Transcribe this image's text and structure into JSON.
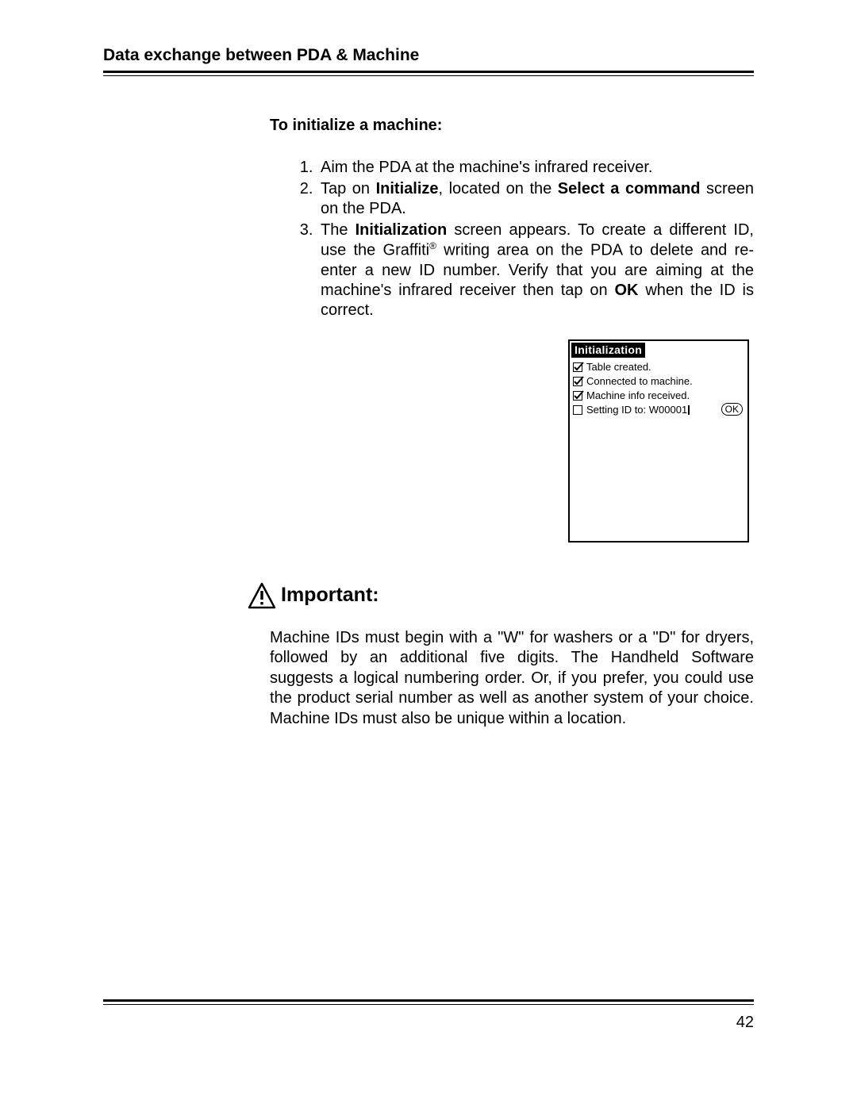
{
  "header": {
    "title": "Data exchange between PDA & Machine"
  },
  "section": {
    "heading": "To initialize a machine:"
  },
  "steps": {
    "s1": "Aim the PDA at the machine's infrared receiver.",
    "s2_pre": "Tap on ",
    "s2_b1": "Initialize",
    "s2_mid": ", located on the ",
    "s2_b2": "Select a command",
    "s2_post": " screen on the PDA.",
    "s3_pre": "The ",
    "s3_b1": "Initialization",
    "s3_mid1": " screen appears. To create a different ID, use the Graffiti",
    "s3_reg": "®",
    "s3_mid2": " writing area on the PDA to delete and re-enter a new ID number. Verify that you are aiming at the machine's infrared receiver then tap on ",
    "s3_b2": "OK",
    "s3_post": " when the ID is correct."
  },
  "pda": {
    "title": "Initialization",
    "items": [
      {
        "label": "Table created.",
        "checked": true
      },
      {
        "label": "Connected to machine.",
        "checked": true
      },
      {
        "label": "Machine info received.",
        "checked": true
      },
      {
        "label": "Setting ID to: W00001",
        "checked": false
      }
    ],
    "ok": "OK"
  },
  "important": {
    "label": "Important:",
    "body": "Machine IDs must begin with a \"W\" for washers or a \"D\" for dryers, followed by an additional five digits. The Handheld Software suggests a logical numbering order. Or, if you prefer, you could use the product serial number as well as another system of your choice. Machine IDs must also be unique within a location."
  },
  "page_number": "42"
}
